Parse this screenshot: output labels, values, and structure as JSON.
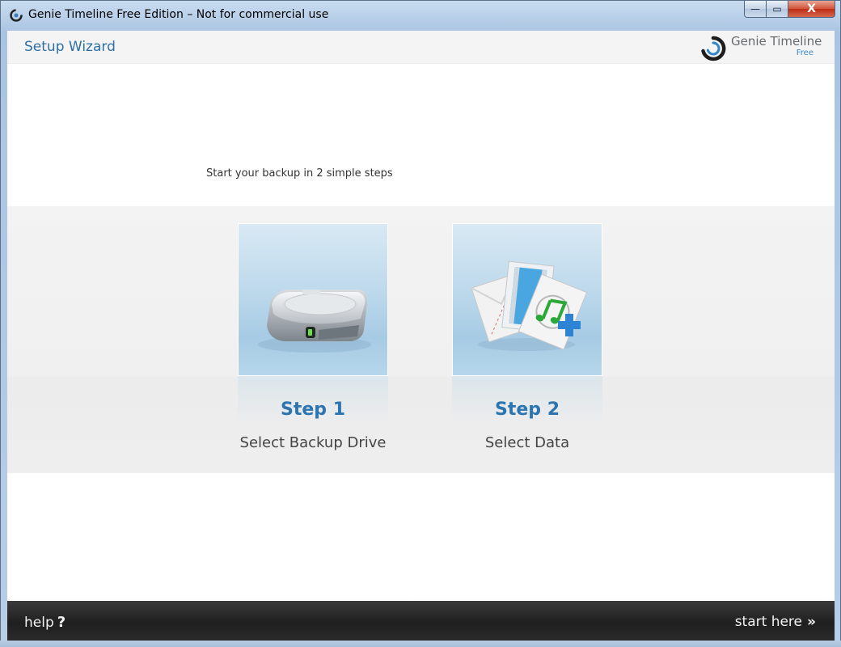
{
  "window": {
    "title": "Genie Timeline Free Edition – Not for commercial use",
    "controls": {
      "minimize": "—",
      "maximize": "▭",
      "close": "X"
    }
  },
  "header": {
    "title": "Setup Wizard",
    "brand_name": "Genie Timeline",
    "brand_edition": "Free"
  },
  "main": {
    "intro": "Start your backup in 2 simple steps",
    "steps": [
      {
        "title": "Step 1",
        "subtitle": "Select Backup Drive",
        "icon": "hard-drive-icon"
      },
      {
        "title": "Step 2",
        "subtitle": "Select Data",
        "icon": "files-add-icon"
      }
    ]
  },
  "footer": {
    "help_label": "help",
    "help_glyph": "?",
    "start_label": "start here",
    "start_glyph": "»"
  },
  "colors": {
    "accent": "#2c75b0",
    "header_title": "#2e6fa5",
    "footer_bg": "#262626"
  }
}
